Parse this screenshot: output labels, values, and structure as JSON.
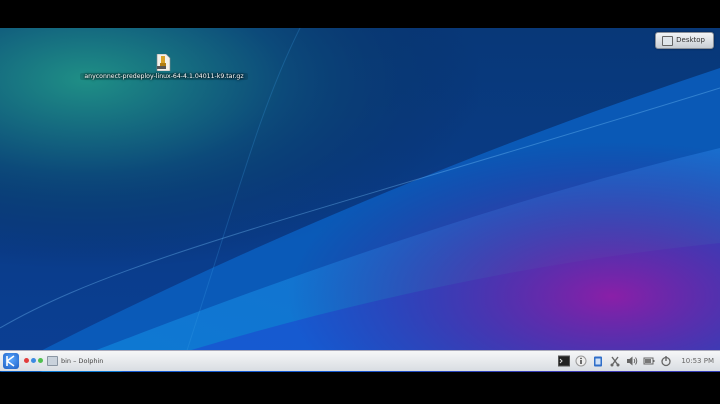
{
  "desktop": {
    "toolbox_label": "Desktop",
    "file": {
      "name": "anyconnect-predeploy-linux-64-4.1.04011-k9.tar.gz",
      "icon": "archive-icon"
    }
  },
  "panel": {
    "launcher_icon": "kde-launcher-icon",
    "pager_colors": [
      "#e23c3c",
      "#3c8be2",
      "#4fbf4f"
    ],
    "task_label": "bin – Dolphin",
    "tray_icons": [
      "terminal-icon",
      "info-icon",
      "clipboard-icon",
      "network-icon",
      "volume-icon",
      "battery-icon",
      "power-icon"
    ],
    "clock": "10:53 PM"
  }
}
